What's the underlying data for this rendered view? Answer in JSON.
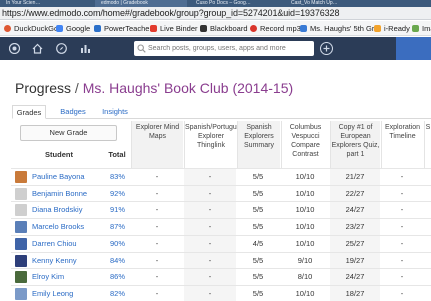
{
  "browser": {
    "tabs": [
      "In Your Scien…",
      "edmodo | Gradebook",
      "Cuso Po Docs – Goog…",
      "Cast_Vo Match Up…"
    ],
    "url": "https://www.edmodo.com/home#/gradebook/group?group_id=5274201&uid=19376328",
    "bookmarks": [
      {
        "label": "DuckDuckGo",
        "color": "#de5833"
      },
      {
        "label": "Google",
        "color": "#4285f4"
      },
      {
        "label": "PowerTeacher",
        "color": "#2b70c9"
      },
      {
        "label": "Live Binder",
        "color": "#e23b2e"
      },
      {
        "label": "Blackboard",
        "color": "#333333"
      },
      {
        "label": "Record mp3",
        "color": "#d9342b"
      },
      {
        "label": "Ms. Haughs' 5th Gr…",
        "color": "#3a7bd5"
      },
      {
        "label": "i-Ready",
        "color": "#f2a32c"
      },
      {
        "label": "Ima…",
        "color": "#6aa84f"
      }
    ]
  },
  "appbar": {
    "search_placeholder": "Search posts, groups, users, apps and more",
    "icons": [
      "edmodo-logo-icon",
      "home-icon",
      "compass-icon",
      "bars-icon",
      "search-icon",
      "plus-icon"
    ]
  },
  "page": {
    "title_prefix": "Progress",
    "separator": "/",
    "group_name": "Ms. Haughs' Book Club (2014-15)"
  },
  "tabs": [
    "Grades",
    "Badges",
    "Insights"
  ],
  "new_grade_label": "New Grade",
  "table": {
    "student_header": "Student",
    "total_header": "Total",
    "columns": [
      "Explorer Mind Maps",
      "Spanish/Portuguese Explorer Thinglink",
      "Spanish Explorers Summary",
      "Columbus Vespucci Compare Contrast",
      "Copy #1 of European Explorers Quiz, part 1",
      "Exploration Timeline",
      "S"
    ],
    "rows": [
      {
        "name": "Pauline Bayona",
        "total": "83%",
        "values": [
          "-",
          "-",
          "5/5",
          "10/10",
          "21/27",
          "-"
        ],
        "avatar": "#c97a3a"
      },
      {
        "name": "Benjamin Bonne",
        "total": "92%",
        "values": [
          "-",
          "-",
          "5/5",
          "10/10",
          "22/27",
          "-"
        ],
        "avatar": "#cfcfcf"
      },
      {
        "name": "Diana Brodskiy",
        "total": "91%",
        "values": [
          "-",
          "-",
          "5/5",
          "10/10",
          "24/27",
          "-"
        ],
        "avatar": "#cfcfcf"
      },
      {
        "name": "Marcelo Brooks",
        "total": "87%",
        "values": [
          "-",
          "-",
          "5/5",
          "10/10",
          "23/27",
          "-"
        ],
        "avatar": "#5a7fb8"
      },
      {
        "name": "Darren Chiou",
        "total": "90%",
        "values": [
          "-",
          "-",
          "4/5",
          "10/10",
          "25/27",
          "-"
        ],
        "avatar": "#3f64a8"
      },
      {
        "name": "Kenny Kenny",
        "total": "84%",
        "values": [
          "-",
          "-",
          "5/5",
          "9/10",
          "19/27",
          "-"
        ],
        "avatar": "#2e3f7a"
      },
      {
        "name": "Elroy Kim",
        "total": "86%",
        "values": [
          "-",
          "-",
          "5/5",
          "8/10",
          "24/27",
          "-"
        ],
        "avatar": "#4a6a3c"
      },
      {
        "name": "Emily Leong",
        "total": "82%",
        "values": [
          "-",
          "-",
          "5/5",
          "10/10",
          "18/27",
          "-"
        ],
        "avatar": "#7b9ac8"
      }
    ]
  }
}
